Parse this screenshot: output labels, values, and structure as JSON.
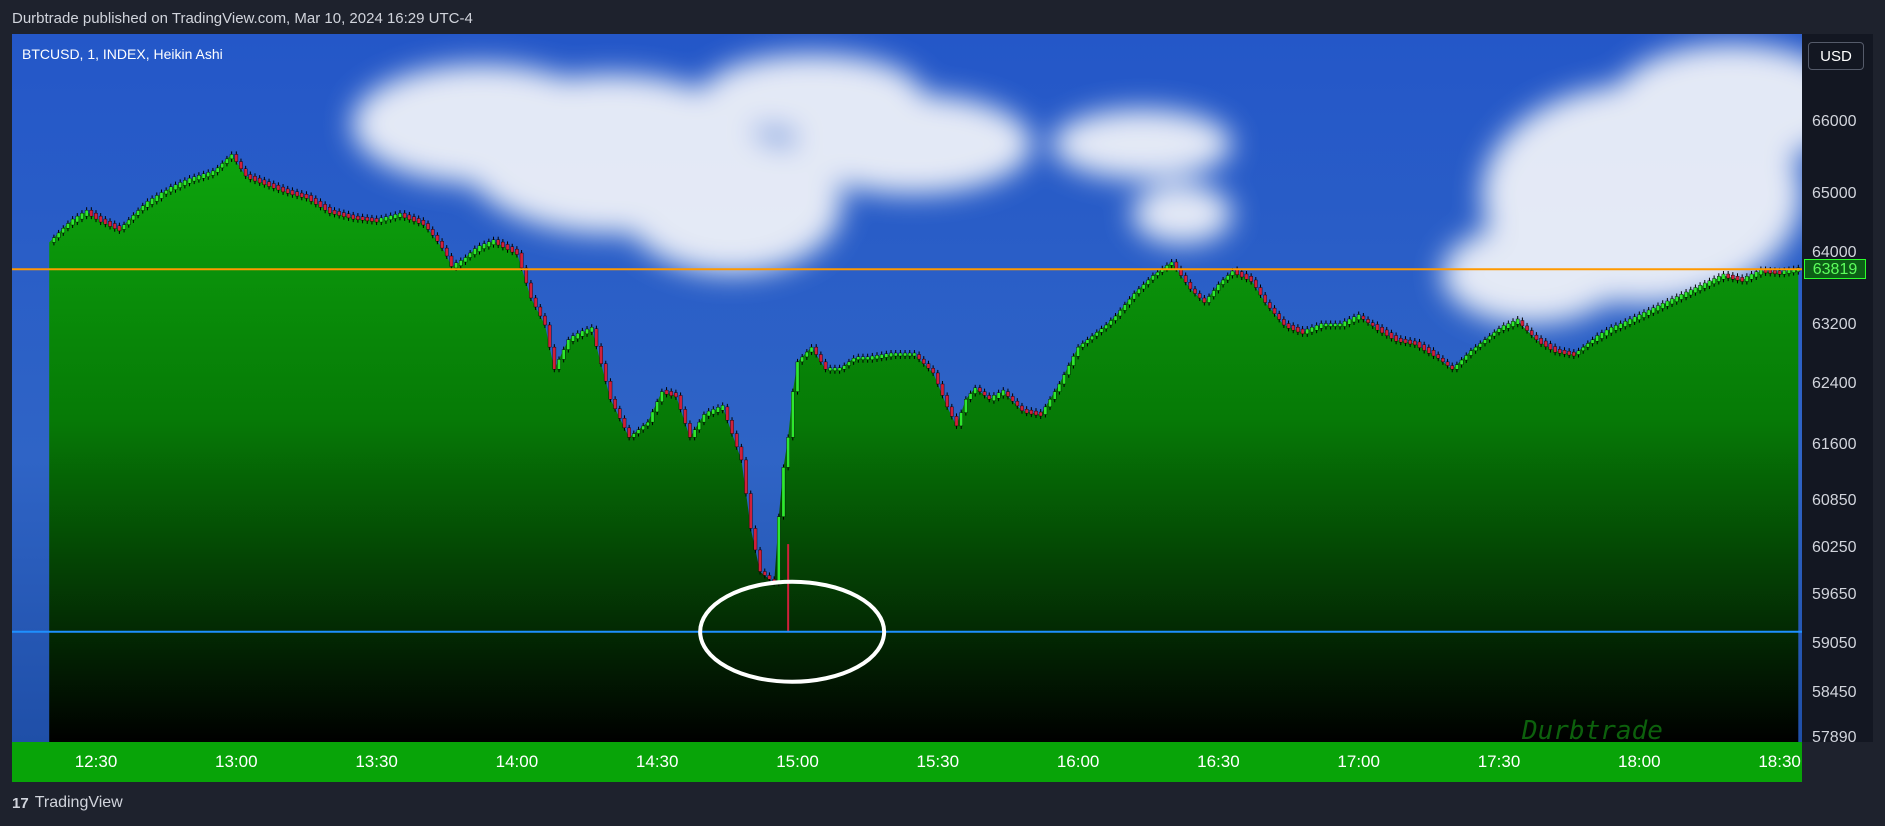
{
  "publisher_line": "Durbtrade published on TradingView.com, Mar 10, 2024 16:29 UTC-4",
  "symbol_label": "BTCUSD, 1, INDEX, Heikin Ashi",
  "currency_button": "USD",
  "last_price_badge": "63819",
  "watermark": "Durbtrade",
  "footer_logo": "17",
  "footer_brand": "TradingView",
  "colors": {
    "up": "#2ee82e",
    "down": "#d0203a",
    "area_top": "#0a9a0a",
    "sky": "#2d5fc4",
    "resistance_line": "#ff9900",
    "support_line": "#1e90ff",
    "x_axis_bg": "#08a408"
  },
  "chart_data": {
    "type": "line",
    "style": "heikin-ashi candlesticks with filled area",
    "y_ticks": [
      66000,
      65000,
      64000,
      63200,
      62400,
      61600,
      60850,
      60250,
      59650,
      59050,
      58450,
      57890
    ],
    "x_ticks": [
      "12:30",
      "13:00",
      "13:30",
      "14:00",
      "14:30",
      "15:00",
      "15:30",
      "16:00",
      "16:30",
      "17:00",
      "17:30",
      "18:00",
      "18:30"
    ],
    "x_range": [
      "12:20",
      "18:34"
    ],
    "resistance_price": 63819,
    "support_price": 59200,
    "low_marker": {
      "time": "14:58",
      "price": 59200
    },
    "series": [
      {
        "x": [
          "12:20",
          "12:24",
          "12:28",
          "12:31",
          "12:35",
          "12:40",
          "12:45",
          "12:50",
          "12:55",
          "12:59",
          "13:02",
          "13:06",
          "13:10",
          "13:15",
          "13:20",
          "13:25",
          "13:30",
          "13:35",
          "13:40",
          "13:43",
          "13:46",
          "13:48",
          "13:52",
          "13:55",
          "14:00",
          "14:03",
          "14:06",
          "14:08",
          "14:11",
          "14:14",
          "14:16",
          "14:20",
          "14:24",
          "14:28",
          "14:31",
          "14:34",
          "14:37",
          "14:40",
          "14:44",
          "14:48",
          "14:50",
          "14:52",
          "14:55",
          "14:56",
          "14:57",
          "14:58",
          "14:59",
          "15:00",
          "15:03",
          "15:06",
          "15:09",
          "15:12",
          "15:15",
          "15:20",
          "15:25",
          "15:29",
          "15:32",
          "15:34",
          "15:36",
          "15:38",
          "15:41",
          "15:44",
          "15:48",
          "15:52",
          "15:56",
          "16:00",
          "16:04",
          "16:08",
          "16:12",
          "16:16",
          "16:20",
          "16:24",
          "16:27",
          "16:30",
          "16:33",
          "16:37",
          "16:40",
          "16:44",
          "16:48",
          "16:52",
          "16:56",
          "17:00",
          "17:04",
          "17:08",
          "17:12",
          "17:16",
          "17:20",
          "17:24",
          "17:28",
          "17:30",
          "17:34",
          "17:38",
          "17:42",
          "17:46",
          "17:50",
          "17:54",
          "17:58",
          "18:02",
          "18:06",
          "18:10",
          "18:14",
          "18:18",
          "18:22",
          "18:26",
          "18:30",
          "18:34"
        ],
        "values": [
          64180,
          64500,
          64700,
          64550,
          64400,
          64800,
          65050,
          65200,
          65300,
          65550,
          65250,
          65150,
          65050,
          64950,
          64700,
          64600,
          64550,
          64650,
          64500,
          64200,
          63850,
          63900,
          64100,
          64200,
          64000,
          63500,
          63200,
          62600,
          63000,
          63100,
          63150,
          62200,
          61700,
          61900,
          62300,
          62250,
          61700,
          62000,
          62100,
          61400,
          60500,
          59950,
          59800,
          60650,
          61300,
          61700,
          62300,
          62700,
          62900,
          62600,
          62600,
          62750,
          62750,
          62800,
          62800,
          62550,
          62100,
          61850,
          62200,
          62350,
          62200,
          62300,
          62050,
          62000,
          62400,
          62900,
          63100,
          63300,
          63550,
          63750,
          63900,
          63600,
          63450,
          63650,
          63800,
          63700,
          63450,
          63200,
          63100,
          63200,
          63200,
          63300,
          63150,
          63000,
          62950,
          62800,
          62600,
          62850,
          63050,
          63150,
          63250,
          63000,
          62850,
          62800,
          63000,
          63150,
          63250,
          63350,
          63450,
          63550,
          63650,
          63750,
          63700,
          63800,
          63780,
          63819
        ]
      }
    ]
  }
}
